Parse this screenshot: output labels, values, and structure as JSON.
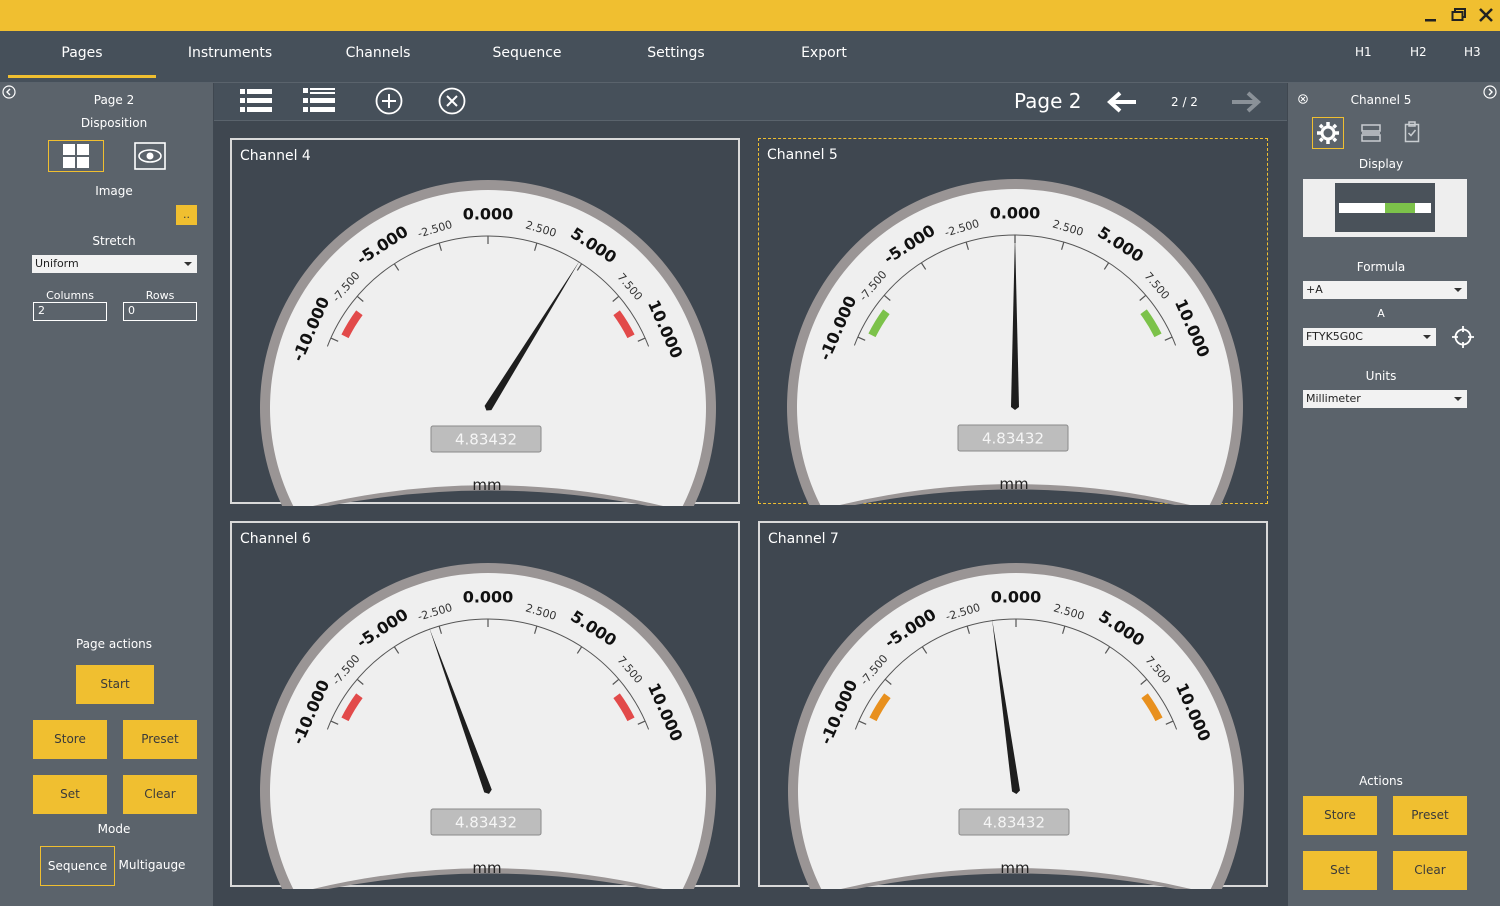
{
  "menu": {
    "items": [
      "Pages",
      "Instruments",
      "Channels",
      "Sequence",
      "Settings",
      "Export"
    ],
    "active": "Pages",
    "heads": [
      "H1",
      "H2",
      "H3"
    ]
  },
  "left_panel": {
    "page_title": "Page 2",
    "disposition_label": "Disposition",
    "image_label": "Image",
    "image_button": "..",
    "stretch_label": "Stretch",
    "stretch_value": "Uniform",
    "columns_label": "Columns",
    "columns_value": "2",
    "rows_label": "Rows",
    "rows_value": "0",
    "page_actions_label": "Page actions",
    "start_label": "Start",
    "store_label": "Store",
    "preset_label": "Preset",
    "set_label": "Set",
    "clear_label": "Clear",
    "mode_label": "Mode",
    "mode_sequence": "Sequence",
    "mode_multigauge": "Multigauge"
  },
  "toolbar": {
    "page_title": "Page 2",
    "page_counter": "2 / 2"
  },
  "gauges": [
    {
      "title": "Channel 4",
      "value_text": "4.83432",
      "unit": "mm",
      "needle_value": 4.83432,
      "limit_color": "#e24a4a",
      "selected": false
    },
    {
      "title": "Channel 5",
      "value_text": "4.83432",
      "unit": "mm",
      "needle_value": 0.0,
      "limit_color": "#7cc24a",
      "selected": true
    },
    {
      "title": "Channel 6",
      "value_text": "4.83432",
      "unit": "mm",
      "needle_value": -3.0,
      "limit_color": "#e24a4a",
      "selected": false
    },
    {
      "title": "Channel 7",
      "value_text": "4.83432",
      "unit": "mm",
      "needle_value": -1.2,
      "limit_color": "#e8901e",
      "selected": false
    }
  ],
  "scale": {
    "min": -10.0,
    "max": 10.0,
    "major_labels": [
      "-10.000",
      "-5.000",
      "0.000",
      "5.000",
      "10.000"
    ],
    "minor_labels": [
      "-7.500",
      "-2.500",
      "2.500",
      "7.500"
    ]
  },
  "right_panel": {
    "title": "Channel 5",
    "display_label": "Display",
    "formula_label": "Formula",
    "formula_value": "+A",
    "a_label": "A",
    "a_value": "FTYK5G0C",
    "units_label": "Units",
    "units_value": "Millimeter",
    "actions_label": "Actions",
    "store_label": "Store",
    "preset_label": "Preset",
    "set_label": "Set",
    "clear_label": "Clear"
  },
  "colors": {
    "accent": "#f0bf30",
    "panel": "#5b636b",
    "background": "#3f4750"
  }
}
